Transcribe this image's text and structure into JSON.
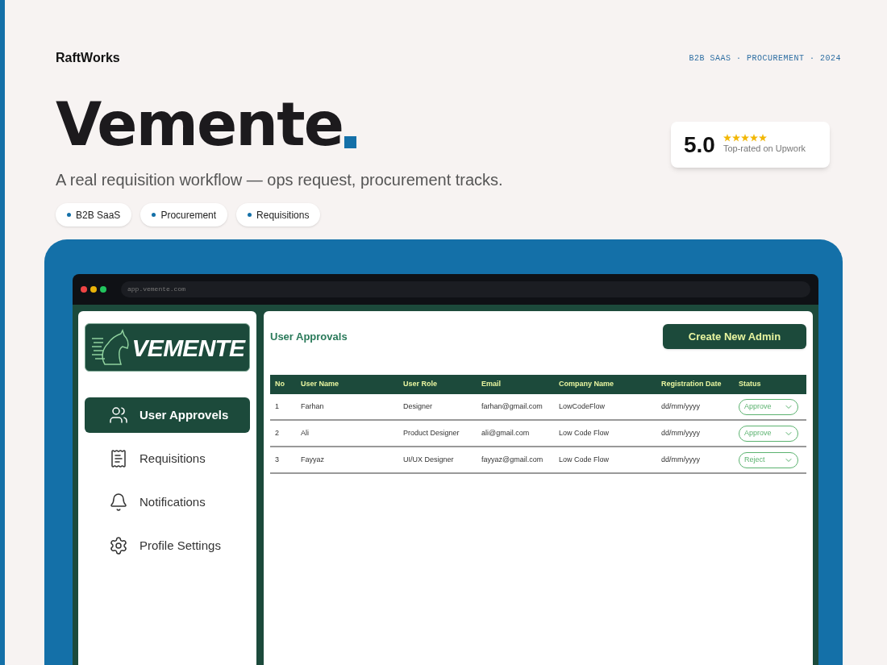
{
  "brand": "RaftWorks",
  "meta": "B2B SAAS · PROCUREMENT · 2024",
  "title": "Vemente",
  "tagline": "A real requisition workflow — ops request, procurement tracks.",
  "tags": [
    "B2B SaaS",
    "Procurement",
    "Requisitions"
  ],
  "rating": {
    "score": "5.0",
    "stars": 5,
    "caption": "Top-rated on Upwork"
  },
  "browser": {
    "url": "app.vemente.com"
  },
  "app": {
    "logo_text": "VEMENTE",
    "nav": [
      {
        "label": "User Approvels",
        "kind": "users",
        "selected": true
      },
      {
        "label": "Requisitions",
        "kind": "requisitions",
        "selected": false
      },
      {
        "label": "Notifications",
        "kind": "notifications",
        "selected": false
      },
      {
        "label": "Profile Settings",
        "kind": "settings",
        "selected": false
      }
    ],
    "page_title": "User Approvals",
    "create_button": "Create New Admin",
    "table": {
      "columns": [
        "No",
        "User Name",
        "User Role",
        "Email",
        "Company Name",
        "Registration Date",
        "Status"
      ],
      "rows": [
        {
          "cells": [
            "1",
            "Farhan",
            "Designer",
            "farhan@gmail.com",
            "LowCodeFlow",
            "dd/mm/yyyy"
          ],
          "status": "Approve"
        },
        {
          "cells": [
            "2",
            "Ali",
            "Product Designer",
            "ali@gmail.com",
            "Low Code Flow",
            "dd/mm/yyyy"
          ],
          "status": "Approve"
        },
        {
          "cells": [
            "3",
            "Fayyaz",
            "UI/UX Designer",
            "fayyaz@gmail.com",
            "Low Code Flow",
            "dd/mm/yyyy"
          ],
          "status": "Reject"
        }
      ]
    }
  }
}
